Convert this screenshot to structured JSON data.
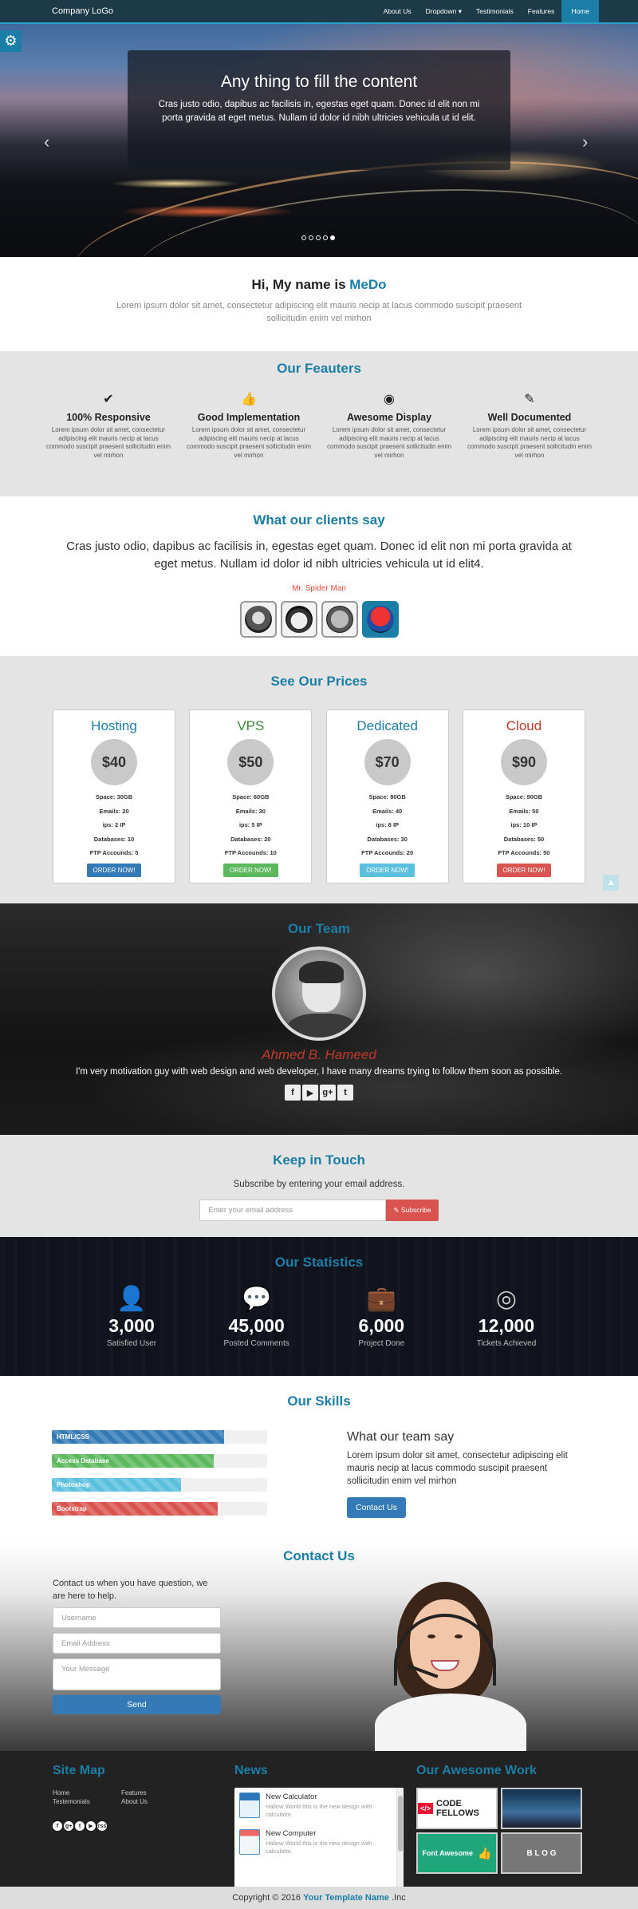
{
  "navbar": {
    "brand": "Company LoGo",
    "items": [
      "About Us",
      "Dropdown ▾",
      "Testimonials",
      "Features",
      "Home"
    ],
    "active": "Home"
  },
  "hero": {
    "title": "Any thing to fill the content",
    "text": "Cras justo odio, dapibus ac facilisis in, egestas eget quam. Donec id elit non mi porta gravida at eget metus. Nullam id dolor id nibh ultricies vehicula ut id elit.",
    "prev_icon": "chevron-left-icon",
    "next_icon": "chevron-right-icon",
    "slides": 5,
    "active_slide": 5
  },
  "intro": {
    "prefix": "Hi, My name is ",
    "name": "MeDo",
    "text": "Lorem ipsum dolor sit amet, consectetur adipiscing elit mauris necip at lacus commodo suscipit praesent sollicitudin enim vel mirhon"
  },
  "features": {
    "title": "Our Feauters",
    "items": [
      {
        "icon": "check-icon",
        "title": "100% Responsive",
        "text": "Lorem ipsum dolor sit amet, consectetur adipiscing elit mauris necip at lacus commodo suscipit praesent sollicitudin enim vel mirhon"
      },
      {
        "icon": "thumbs-up-icon",
        "title": "Good Implementation",
        "text": "Lorem ipsum dolor sit amet, consectetur adipiscing elit mauris necip at lacus commodo suscipit praesent sollicitudin enim vel mirhon"
      },
      {
        "icon": "eye-icon",
        "title": "Awesome Display",
        "text": "Lorem ipsum dolor sit amet, consectetur adipiscing elit mauris necip at lacus commodo suscipit praesent sollicitudin enim vel mirhon"
      },
      {
        "icon": "pencil-icon",
        "title": "Well Documented",
        "text": "Lorem ipsum dolor sit amet, consectetur adipiscing elit mauris necip at lacus commodo suscipit praesent sollicitudin enim vel mirhon"
      }
    ]
  },
  "testimonials": {
    "title": "What our clients say",
    "quote": "Cras justo odio, dapibus ac facilisis in, egestas eget quam. Donec id elit non mi porta gravida at eget metus. Nullam id dolor id nibh ultricies vehicula ut id elit4.",
    "author": "Mr. Spider Man",
    "avatars": [
      "iron-man-avatar",
      "hulk-avatar",
      "thing-avatar",
      "spider-man-avatar"
    ]
  },
  "prices": {
    "title": "See Our Prices",
    "plans": [
      {
        "name": "Hosting",
        "color": "#1b7ea6",
        "price": "$40",
        "space": "Space: 30GB",
        "emails": "Emails: 20",
        "ips": "ips: 2 IP",
        "databases": "Databases: 10",
        "ftp": "FTP Accounds: 5",
        "button": "ORDER NOW!",
        "btn_color": "#337ab7"
      },
      {
        "name": "VPS",
        "color": "#3a8a3a",
        "price": "$50",
        "space": "Space: 60GB",
        "emails": "Emails: 30",
        "ips": "ips: 5 IP",
        "databases": "Databases: 20",
        "ftp": "FTP Accounds: 10",
        "button": "ORDER NOW!",
        "btn_color": "#5cb85c"
      },
      {
        "name": "Dedicated",
        "color": "#1b7ea6",
        "price": "$70",
        "space": "Space: 80GB",
        "emails": "Emails: 40",
        "ips": "ips: 8 IP",
        "databases": "Databases: 30",
        "ftp": "FTP Accounds: 20",
        "button": "ORDER NOW!",
        "btn_color": "#5bc0de"
      },
      {
        "name": "Cloud",
        "color": "#c0392b",
        "price": "$90",
        "space": "Space: 90GB",
        "emails": "Emails: 50",
        "ips": "ips: 10 IP",
        "databases": "Databases: 50",
        "ftp": "FTP Accounds: 50",
        "button": "ORDER NOW!",
        "btn_color": "#d9534f"
      }
    ]
  },
  "team": {
    "title": "Our Team",
    "name": "Ahmed B. Hameed",
    "bio": "I'm very motivation guy with web design and web developer, I have many dreams trying to follow them soon as possible.",
    "social": [
      {
        "icon": "facebook-icon",
        "glyph": "f"
      },
      {
        "icon": "youtube-icon",
        "glyph": "▶"
      },
      {
        "icon": "google-plus-icon",
        "glyph": "g+"
      },
      {
        "icon": "twitter-icon",
        "glyph": "t"
      }
    ]
  },
  "touch": {
    "title": "Keep in Touch",
    "text": "Subscribe by entering your email address.",
    "placeholder": "Enter your email address",
    "button": "✎ Subscribe"
  },
  "stats": {
    "title": "Our Statistics",
    "items": [
      {
        "icon": "user-icon",
        "glyph": "👤",
        "num": "3,000",
        "label": "Satisfied User"
      },
      {
        "icon": "comments-icon",
        "glyph": "💬",
        "num": "45,000",
        "label": "Posted Comments"
      },
      {
        "icon": "briefcase-icon",
        "glyph": "💼",
        "num": "6,000",
        "label": "Project Done"
      },
      {
        "icon": "life-ring-icon",
        "glyph": "◎",
        "num": "12,000",
        "label": "Tickets Achieved"
      }
    ]
  },
  "skills": {
    "title": "Our Skills",
    "bars": [
      {
        "label": "HTML/CSS",
        "value": 80,
        "color": "#337ab7"
      },
      {
        "label": "Access Database",
        "value": 75,
        "color": "#5cb85c"
      },
      {
        "label": "Photoshop",
        "value": 60,
        "color": "#5bc0de"
      },
      {
        "label": "Bootstrap",
        "value": 77,
        "color": "#d9534f"
      }
    ],
    "say_title": "What our team say",
    "say_text": "Lorem ipsum dolor sit amet, consectetur adipiscing elit mauris necip at lacus commodo suscipit praesent sollicitudin enim vel mirhon",
    "button": "Contact Us"
  },
  "contact": {
    "title": "Contact Us",
    "text": "Contact us when you have question, we are here to help.",
    "username": "Username",
    "email": "Email Address",
    "message": "Your Message",
    "send": "Send"
  },
  "footer": {
    "sitemap_title": "Site Map",
    "links": [
      "Home",
      "Testemonials",
      "Features",
      "About Us"
    ],
    "social": [
      "f",
      "g+",
      "t",
      "▶",
      "rss"
    ],
    "news_title": "News",
    "news": [
      {
        "title": "New Calculator",
        "text": "Hallow World this is the new design with calculator."
      },
      {
        "title": "New Computer",
        "text": "Hallow World this is the new design with calculator."
      }
    ],
    "work_title": "Our Awesome Work",
    "works": [
      "CODE FELLOWS",
      "",
      "Font Awesome",
      "B L O G"
    ],
    "copyright_prefix": "Copyright © 2016 ",
    "template_name": "Your Template Name",
    "copyright_suffix": " .Inc"
  }
}
